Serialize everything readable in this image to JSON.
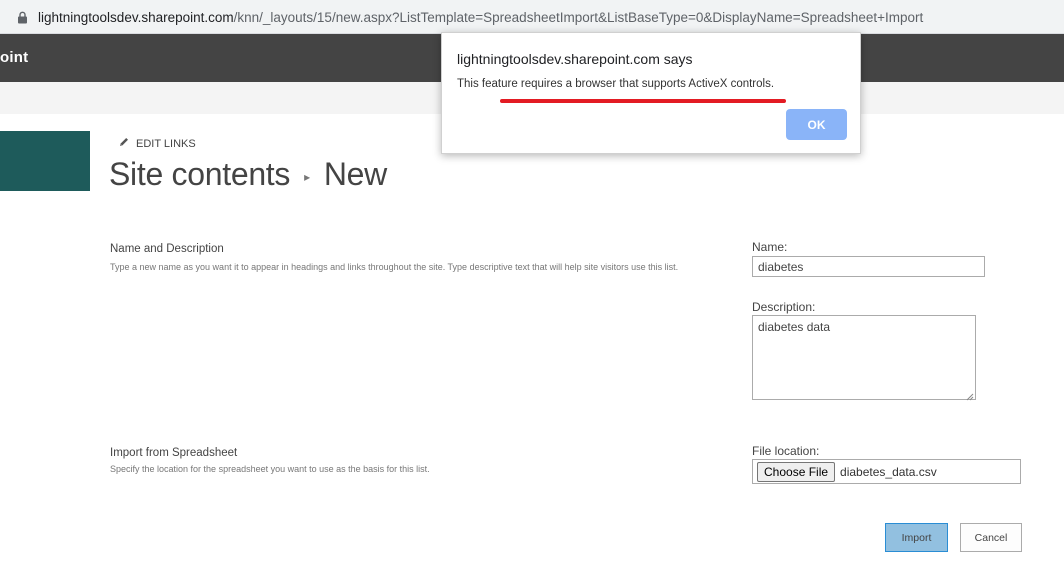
{
  "browser": {
    "url_host": "lightningtoolsdev.sharepoint.com",
    "url_path": "/knn/_layouts/15/new.aspx?ListTemplate=SpreadsheetImport&ListBaseType=0&DisplayName=Spreadsheet+Import"
  },
  "suitebar": {
    "brand": "oint",
    "bg_color": "#444444"
  },
  "page": {
    "edit_links": "EDIT LINKS",
    "breadcrumb_parent": "Site contents",
    "breadcrumb_current": "New"
  },
  "form": {
    "name_section": {
      "heading": "Name and Description",
      "description": "Type a new name as you want it to appear in headings and links throughout the site. Type descriptive text that will help site visitors use this list.",
      "name_label": "Name:",
      "name_value": "diabetes",
      "desc_label": "Description:",
      "desc_value": "diabetes data"
    },
    "import_section": {
      "heading": "Import from Spreadsheet",
      "description": "Specify the location for the spreadsheet you want to use as the basis for this list.",
      "file_label": "File location:",
      "choose_file_label": "Choose File",
      "file_name": "diabetes_data.csv"
    },
    "import_button": "Import",
    "cancel_button": "Cancel"
  },
  "dialog": {
    "title": "lightningtoolsdev.sharepoint.com says",
    "message": "This feature requires a browser that supports ActiveX controls.",
    "ok_label": "OK",
    "ok_color": "#8ab4f8",
    "highlight_color": "#e31b23"
  },
  "colors": {
    "site_logo": "#1e5b5b",
    "import_button_bg": "#92c0e0"
  }
}
